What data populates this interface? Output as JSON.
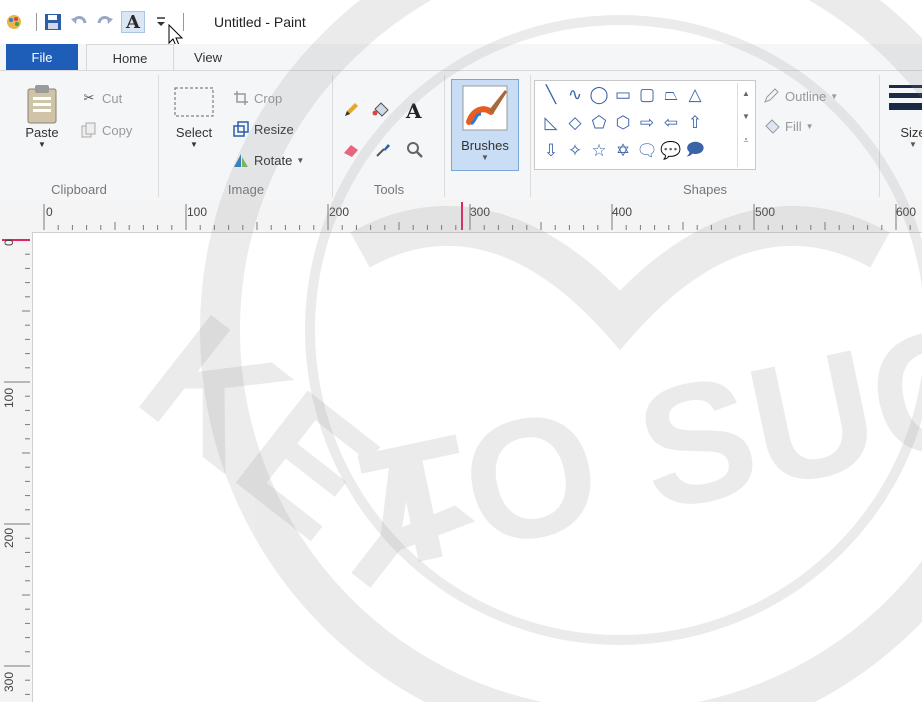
{
  "window": {
    "title": "Untitled - Paint"
  },
  "tabs": {
    "file": "File",
    "home": "Home",
    "view": "View"
  },
  "clipboard": {
    "paste": "Paste",
    "cut": "Cut",
    "copy": "Copy",
    "label": "Clipboard"
  },
  "image": {
    "select": "Select",
    "crop": "Crop",
    "resize": "Resize",
    "rotate": "Rotate",
    "label": "Image"
  },
  "tools": {
    "label": "Tools",
    "text_glyph": "A"
  },
  "brushes": {
    "label": "Brushes"
  },
  "shapes": {
    "label": "Shapes",
    "outline": "Outline",
    "fill": "Fill"
  },
  "size": {
    "label": "Size"
  },
  "ruler": {
    "h_labels": [
      "0",
      "100",
      "200",
      "300",
      "400",
      "500",
      "600"
    ],
    "v_labels": [
      "0",
      "100",
      "200",
      "300"
    ]
  },
  "watermark": {
    "line1": "KEY",
    "line2": "TO SUCC"
  },
  "colors": {
    "file_tab": "#1e5eb8",
    "ribbon": "#f5f6f7",
    "selected_tool": "#c9def5",
    "watermark": "#9a9a9a"
  }
}
